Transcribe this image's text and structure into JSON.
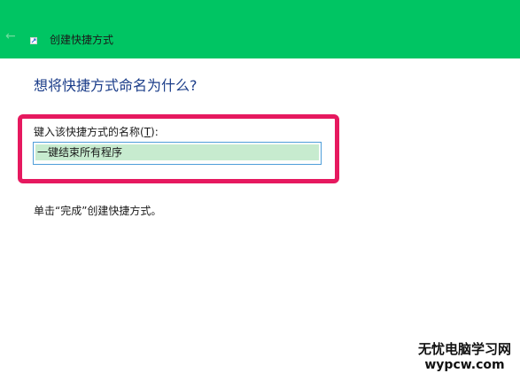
{
  "window": {
    "title": "创建快捷方式",
    "back_icon": "back-arrow-icon",
    "app_icon": "shortcut-icon"
  },
  "heading": "想将快捷方式命名为什么?",
  "name_field": {
    "label_before": "键入该快捷方式的名称(",
    "label_access_key": "T",
    "label_after": "):",
    "value": "一键结束所有程序"
  },
  "hint": "单击“完成”创建快捷方式。",
  "colors": {
    "titlebar": "#00c563",
    "heading": "#1c3e8a",
    "highlight_frame": "#e6195f",
    "input_border": "#4f9ed9",
    "selection": "#c7ebcf"
  },
  "watermark": {
    "name": "无忧电脑学习网",
    "url": "wypcw.com"
  }
}
